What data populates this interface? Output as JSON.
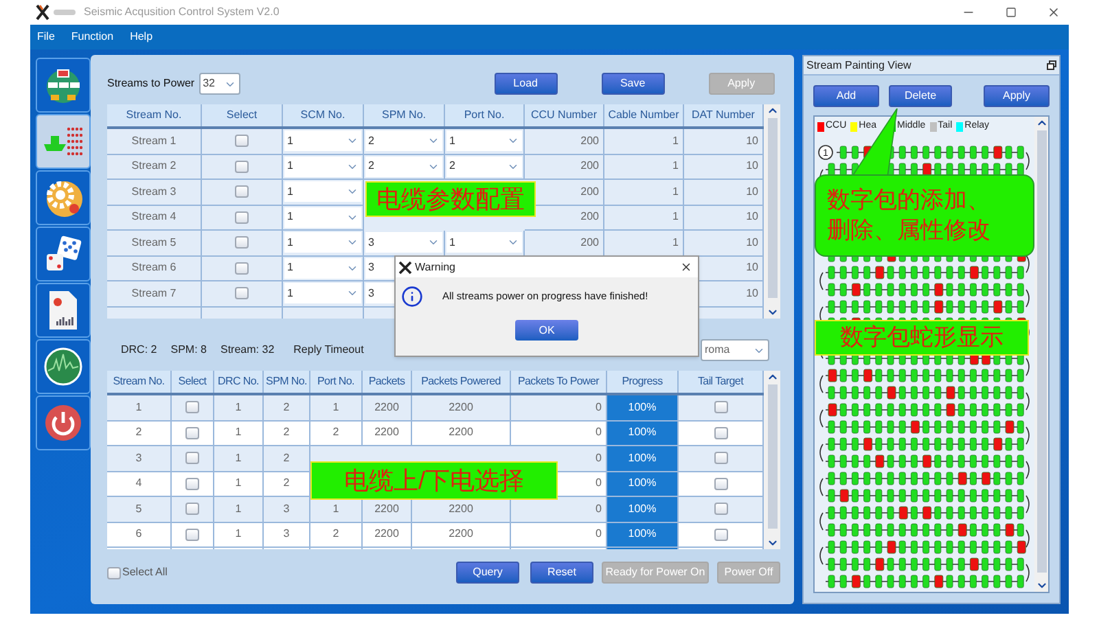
{
  "window": {
    "title": "Seismic Acqusition Control System V2.0"
  },
  "menu": [
    "File",
    "Function",
    "Help"
  ],
  "sidebar": {
    "items": [
      {
        "kind": "network",
        "selected": false
      },
      {
        "kind": "ship",
        "selected": true
      },
      {
        "kind": "gear",
        "selected": false
      },
      {
        "kind": "dice",
        "selected": false
      },
      {
        "kind": "report",
        "selected": false
      },
      {
        "kind": "radar",
        "selected": false
      },
      {
        "kind": "power",
        "selected": false
      }
    ]
  },
  "config": {
    "streams_label": "Streams to Power",
    "streams_value": "32",
    "buttons": [
      {
        "label": "Load",
        "disabled": false
      },
      {
        "label": "Save",
        "disabled": false
      },
      {
        "label": "Apply",
        "disabled": true
      }
    ],
    "table": {
      "columns": [
        "Stream No.",
        "Select",
        "SCM No.",
        "SPM No.",
        "Port No.",
        "CCU Number",
        "Cable Number",
        "DAT Number"
      ],
      "rows": [
        {
          "stream": "Stream 1",
          "checked": false,
          "scm": "1",
          "spm": "2",
          "port": "1",
          "ccu": "200",
          "cable": "1",
          "dat": "10"
        },
        {
          "stream": "Stream 2",
          "checked": false,
          "scm": "1",
          "spm": "2",
          "port": "2",
          "ccu": "200",
          "cable": "1",
          "dat": "10"
        },
        {
          "stream": "Stream 3",
          "checked": false,
          "scm": "1",
          "ccu": "200",
          "cable": "1",
          "dat": "10"
        },
        {
          "stream": "Stream 4",
          "checked": false,
          "scm": "1",
          "ccu": "200",
          "cable": "1",
          "dat": "10"
        },
        {
          "stream": "Stream 5",
          "checked": false,
          "scm": "1",
          "spm": "3",
          "port": "1",
          "ccu": "200",
          "cable": "1",
          "dat": "10"
        },
        {
          "stream": "Stream 6",
          "checked": false,
          "scm": "1",
          "spm": "3",
          "dat": "10"
        },
        {
          "stream": "Stream 7",
          "checked": false,
          "scm": "1",
          "spm": "3",
          "dat": "10"
        }
      ]
    },
    "annotation": "电缆参数配置"
  },
  "power": {
    "summary": [
      {
        "label": "DRC:",
        "value": "2"
      },
      {
        "label": "SPM:",
        "value": "8"
      },
      {
        "label": "Stream:",
        "value": "32"
      }
    ],
    "timeout_label": "Reply Timeout",
    "mode_value": "roma",
    "table": {
      "columns": [
        "Stream No.",
        "Select",
        "DRC No.",
        "SPM No.",
        "Port No.",
        "Packets",
        "Packets Powered",
        "Packets To Power",
        "Progress",
        "Tail Target"
      ],
      "rows": [
        {
          "stream": "1",
          "checked": false,
          "drc": "1",
          "spm": "2",
          "port": "1",
          "packets": "2200",
          "powered": "2200",
          "to_power": "0",
          "progress": "100%",
          "tail": false
        },
        {
          "stream": "2",
          "checked": false,
          "drc": "1",
          "spm": "2",
          "port": "2",
          "packets": "2200",
          "powered": "2200",
          "to_power": "0",
          "progress": "100%",
          "tail": false
        },
        {
          "stream": "3",
          "checked": false,
          "drc": "1",
          "spm": "2",
          "to_power": "0",
          "progress": "100%",
          "tail": false
        },
        {
          "stream": "4",
          "checked": false,
          "drc": "1",
          "spm": "2",
          "to_power": "0",
          "progress": "100%",
          "tail": false
        },
        {
          "stream": "5",
          "checked": false,
          "drc": "1",
          "spm": "3",
          "port": "1",
          "packets": "2200",
          "powered": "2200",
          "to_power": "0",
          "progress": "100%",
          "tail": false
        },
        {
          "stream": "6",
          "checked": false,
          "drc": "1",
          "spm": "3",
          "port": "2",
          "packets": "2200",
          "powered": "2200",
          "to_power": "0",
          "progress": "100%",
          "tail": false
        }
      ]
    },
    "select_all": {
      "label": "Select All",
      "checked": false
    },
    "buttons": [
      {
        "label": "Query",
        "disabled": false
      },
      {
        "label": "Reset",
        "disabled": false
      },
      {
        "label": "Ready for Power On",
        "disabled": true
      },
      {
        "label": "Power Off",
        "disabled": true
      }
    ],
    "annotation": "电缆上/下电选择"
  },
  "dialog": {
    "title": "Warning",
    "message": "All streams power on progress have finished!",
    "button": "OK"
  },
  "painting": {
    "title": "Stream Painting View",
    "buttons": [
      {
        "label": "Add",
        "disabled": false
      },
      {
        "label": "Delete",
        "disabled": false
      },
      {
        "label": "Apply",
        "disabled": false
      }
    ],
    "legend": [
      {
        "label": "CCU",
        "color": "#ff0000"
      },
      {
        "label": "Hea",
        "color": "#ffff00"
      },
      {
        "label": "Middle",
        "color": "#00dd00"
      },
      {
        "label": "Tail",
        "color": "#c0c0c0"
      },
      {
        "label": "Relay",
        "color": "#00ffff"
      }
    ],
    "start_marker": "1",
    "callout_lines": [
      "数字包的添加、",
      "删除、属性修改"
    ],
    "annotation": "数字包蛇形显示"
  }
}
